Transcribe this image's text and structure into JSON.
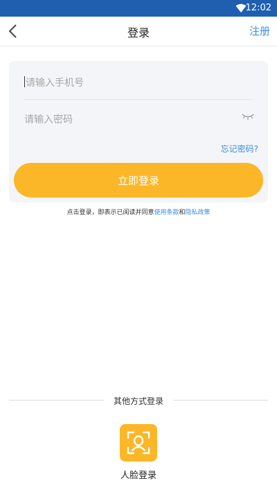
{
  "status_bar": {
    "time": "12:02",
    "icons": [
      "wifi-icon"
    ],
    "color": "#1f5fb0"
  },
  "nav": {
    "back_icon": "chevron-left-icon",
    "title": "登录",
    "register_label": "注册"
  },
  "form": {
    "phone_placeholder": "请输入手机号",
    "password_placeholder": "请输入密码",
    "password_toggle_icon": "eye-closed-icon",
    "forgot_label": "忘记密码?",
    "login_label": "立即登录"
  },
  "agreement": {
    "prefix": "点击登录，即表示已阅读并同意",
    "terms": "使用条款",
    "and": "和",
    "privacy": "隐私政策"
  },
  "other_login": {
    "heading": "其他方式登录",
    "face_icon": "face-id-icon",
    "face_label": "人脸登录"
  },
  "colors": {
    "accent": "#fbb727",
    "link": "#3a8ee6"
  }
}
